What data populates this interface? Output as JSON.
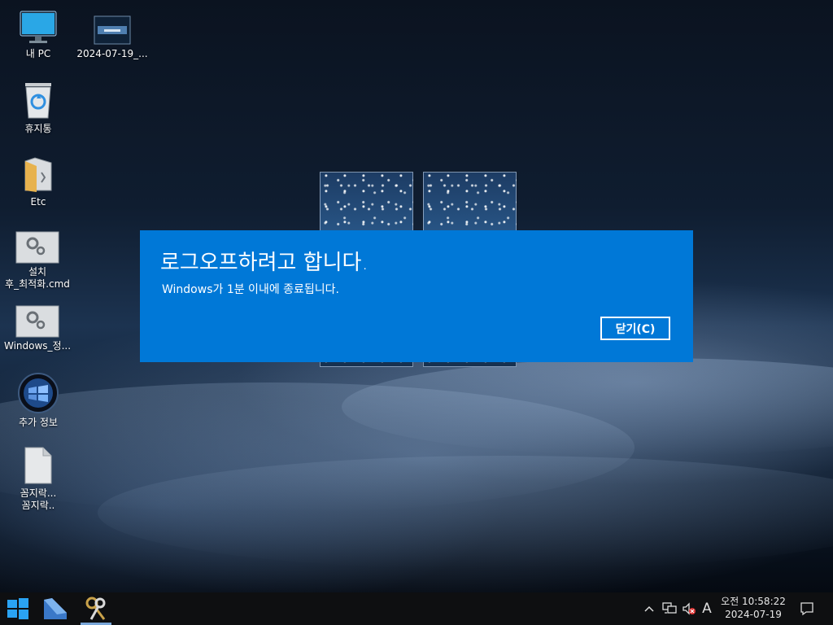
{
  "desktop": {
    "icons": [
      {
        "label": "내 PC",
        "icon": "monitor-icon"
      },
      {
        "label": "2024-07-19_...",
        "icon": "screenshot-thumbnail-icon"
      },
      {
        "label": "휴지통",
        "icon": "recycle-bin-icon"
      },
      {
        "label": "Etc",
        "icon": "folder-icon"
      },
      {
        "label_line1": "설치",
        "label_line2": "후_최적화.cmd",
        "icon": "cmd-gear-icon"
      },
      {
        "label": "Windows_정...",
        "icon": "cmd-gear-icon"
      },
      {
        "label": "추가 정보",
        "icon": "windows-orb-icon"
      },
      {
        "label_line1": "꼼지락...",
        "label_line2": "꼼지락..",
        "icon": "document-icon"
      }
    ]
  },
  "dialog": {
    "title": "로그오프하려고 합니다.",
    "message": "Windows가 1분 이내에 종료됩니다.",
    "close_label": "닫기(C)",
    "background_color": "#0078d7"
  },
  "taskbar": {
    "start_icon": "windows-logo-icon",
    "pinned": [
      "app-tile-icon",
      "keys-tool-icon"
    ],
    "tray": {
      "ime_label": "A",
      "time": "오전 10:58:22",
      "date": "2024-07-19"
    }
  }
}
